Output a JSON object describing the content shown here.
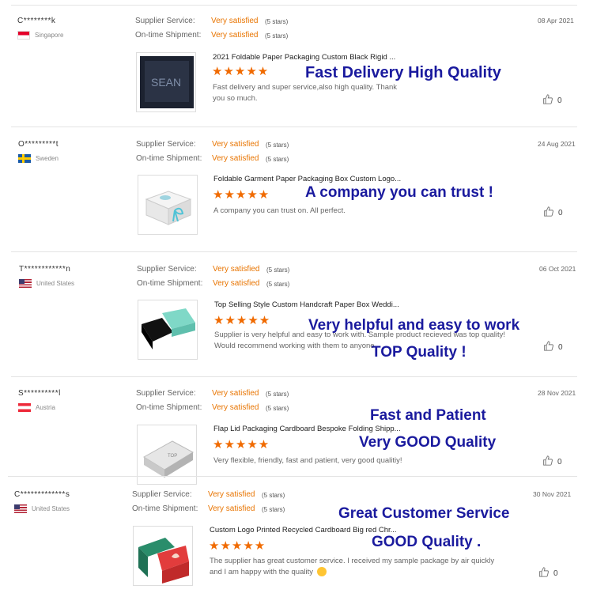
{
  "labels": {
    "supplier_service": "Supplier Service:",
    "ontime_shipment": "On-time Shipment:",
    "rating_value": "Very satisfied",
    "rating_stars": "(5 stars)",
    "product_stars": "★★★★★",
    "like_count": "0"
  },
  "reviews": [
    {
      "user": "C********k",
      "country": "Singapore",
      "date": "08 Apr 2021",
      "product": "2021 Foldable Paper Packaging Custom Black Rigid ...",
      "comment": "Fast delivery and super service,also high quality. Thank you so much.",
      "overlays": [
        "Fast Delivery  High Quality"
      ]
    },
    {
      "user": "O*********t",
      "country": "Sweden",
      "date": "24 Aug 2021",
      "product": "Foldable Garment Paper Packaging Box Custom Logo...",
      "comment": "A company you can trust on. All perfect.",
      "overlays": [
        "A company you can trust !"
      ]
    },
    {
      "user": "T************n",
      "country": "United States",
      "date": "06 Oct 2021",
      "product": "Top Selling Style Custom Handcraft Paper Box Weddi...",
      "comment": "Supplier is very helpful and easy to work with.  Sample product recieved was top quality! Would recommend working with them to anyone.",
      "overlays": [
        "Very helpful and easy to work",
        "TOP Quality !"
      ]
    },
    {
      "user": "S**********l",
      "country": "Austria",
      "date": "28 Nov 2021",
      "product": "Flap Lid Packaging Cardboard Bespoke Folding Shipp...",
      "comment": "Very flexible, friendly, fast and patient, very good qualitiy!",
      "overlays": [
        "Fast and Patient",
        "Very GOOD Quality"
      ]
    },
    {
      "user": "C*************s",
      "country": "United States",
      "date": "30 Nov 2021",
      "product": "Custom Logo Printed Recycled Cardboard Big red Chr...",
      "comment": "The supplier has great customer service. I received my sample package by air quickly and I am happy with the quality",
      "overlays": [
        "Great Customer Service",
        "GOOD Quality ."
      ]
    }
  ],
  "colors": {
    "accent_orange": "#f06a00",
    "overlay_blue": "#1a1a9e"
  },
  "icons": {
    "like": "thumbs-up-icon",
    "emoji": "smiley-icon"
  }
}
